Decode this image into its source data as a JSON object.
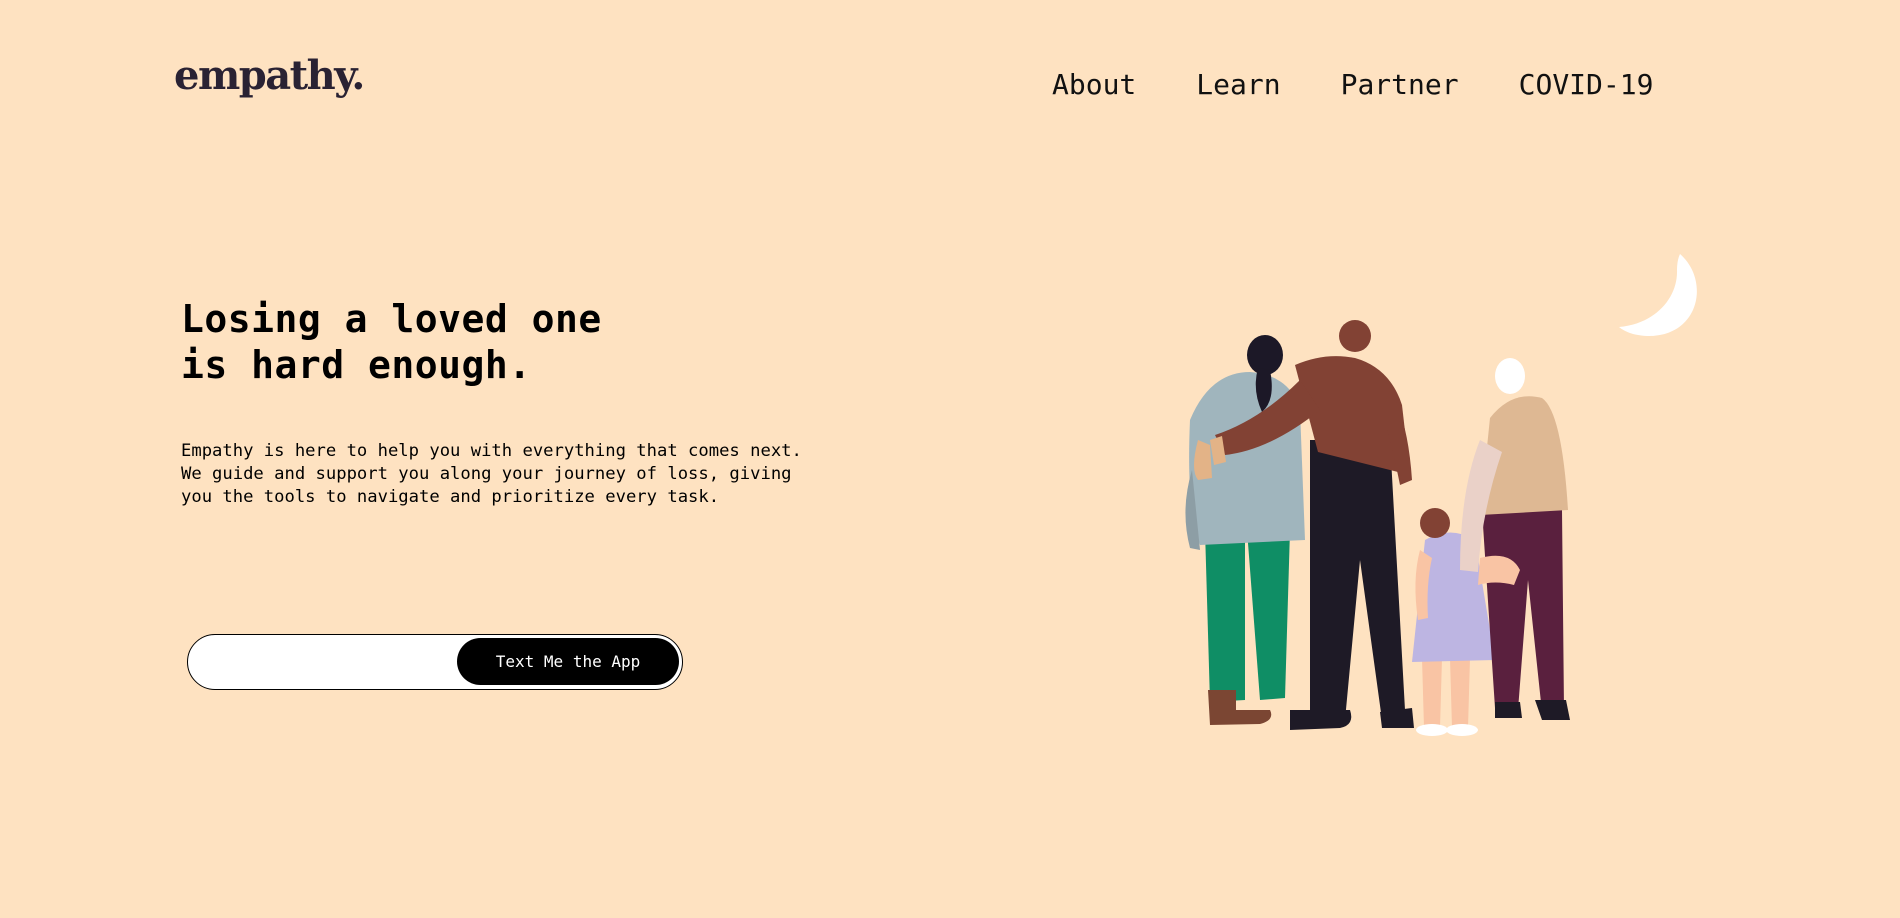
{
  "brand": {
    "logo_text": "empathy."
  },
  "nav": {
    "items": [
      {
        "label": "About"
      },
      {
        "label": "Learn"
      },
      {
        "label": "Partner"
      },
      {
        "label": "COVID-19"
      }
    ]
  },
  "hero": {
    "headline_lines": [
      "Losing a loved one",
      "is hard enough."
    ],
    "description_lines": [
      "Empathy is here to help you with everything that comes next.",
      "We guide and support you along your journey of loss, giving",
      "you the tools to navigate and prioritize every task."
    ],
    "phone_input": {
      "value": "",
      "placeholder": ""
    },
    "cta_label": "Text Me the App"
  },
  "colors": {
    "background": "#FEE2C1",
    "button": "#000000",
    "button_text": "#FFFFFF"
  },
  "illustration": {
    "name": "family-group-illustration",
    "elements": [
      "crescent-moon",
      "woman-in-grey-sweater",
      "man-in-brown-shirt",
      "child-in-lavender-dress",
      "elder-in-tan-shirt"
    ]
  }
}
